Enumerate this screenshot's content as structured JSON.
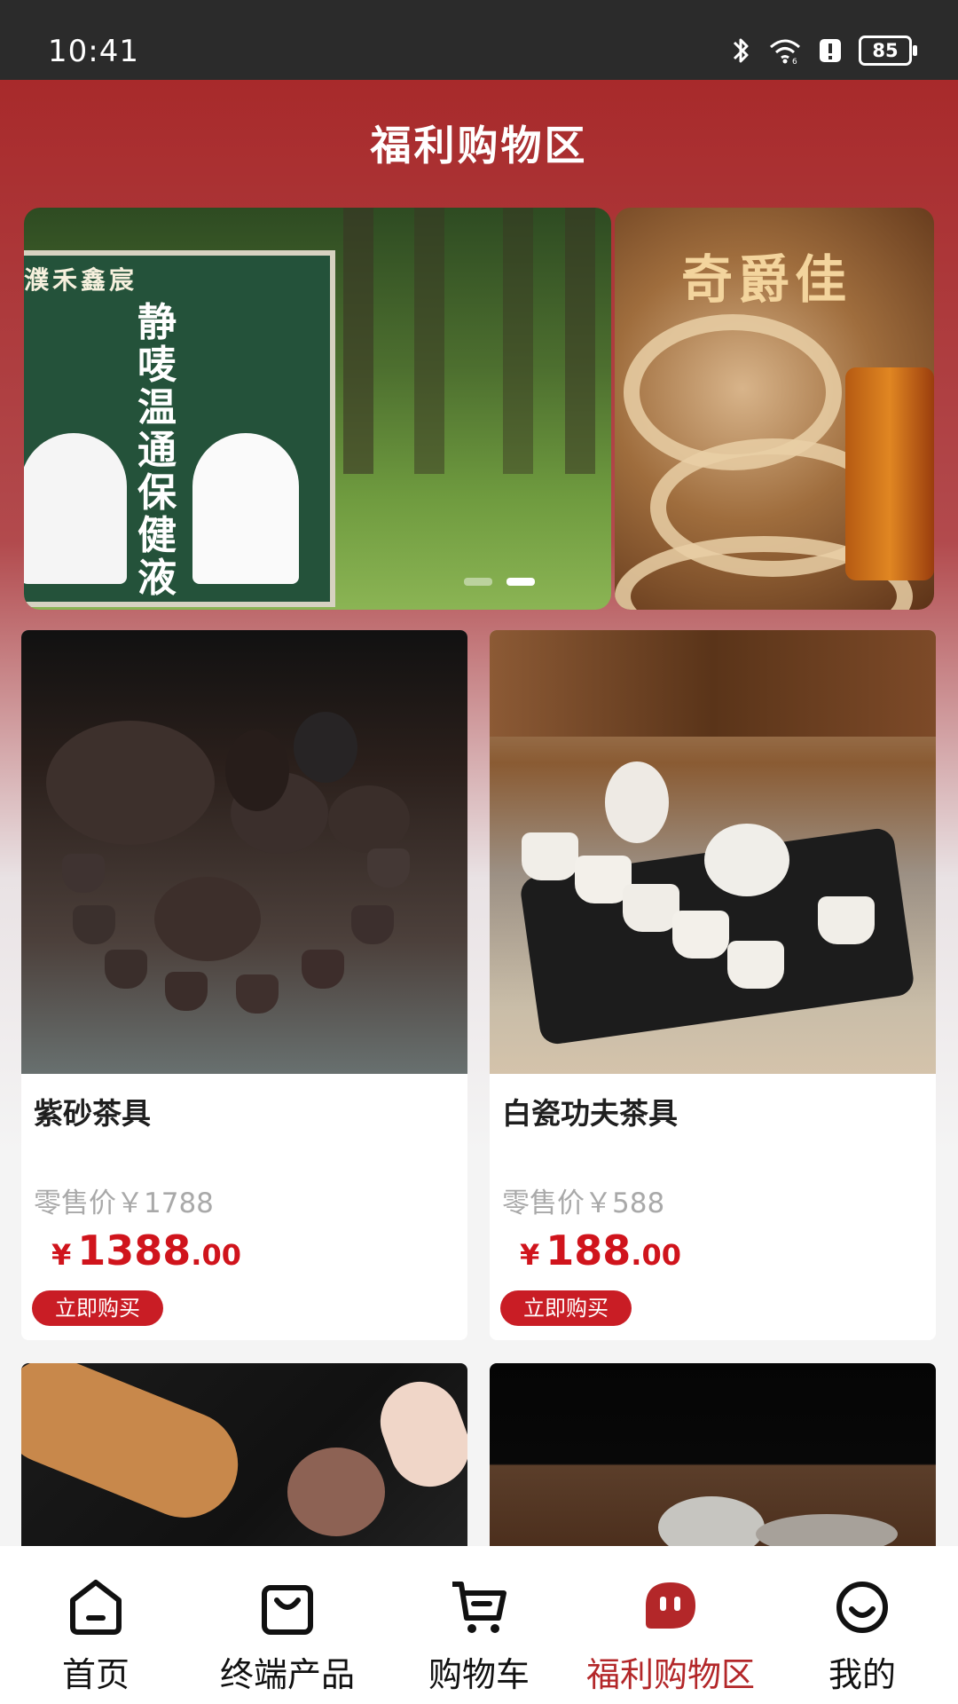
{
  "status_bar": {
    "time": "10:41",
    "battery": "85",
    "icons": [
      "bluetooth-icon",
      "wifi-icon",
      "alert-icon",
      "battery-icon"
    ]
  },
  "page": {
    "title": "福利购物区"
  },
  "banner": {
    "main_brand": "濮禾鑫宸",
    "main_product": "静唛温通保健液",
    "side_brand": "奇爵佳",
    "dots": [
      false,
      true
    ]
  },
  "products": [
    {
      "name": "紫砂茶具",
      "retail_label": "零售价￥1788",
      "price_symbol": "¥",
      "price_int": "1388",
      "price_dec": ".00",
      "button": "立即购买"
    },
    {
      "name": "白瓷功夫茶具",
      "retail_label": "零售价￥588",
      "price_symbol": "¥",
      "price_int": "188",
      "price_dec": ".00",
      "button": "立即购买"
    }
  ],
  "tabbar": {
    "items": [
      {
        "label": "首页",
        "icon": "home-icon",
        "active": false
      },
      {
        "label": "终端产品",
        "icon": "shopping-bag-icon",
        "active": false
      },
      {
        "label": "购物车",
        "icon": "cart-icon",
        "active": false
      },
      {
        "label": "福利购物区",
        "icon": "welfare-chat-icon",
        "active": true
      },
      {
        "label": "我的",
        "icon": "profile-smile-icon",
        "active": false
      }
    ]
  },
  "colors": {
    "header_red": "#a82a2b",
    "price_red": "#d0141c",
    "active_tab": "#b32729",
    "button_red": "#c91d25"
  }
}
